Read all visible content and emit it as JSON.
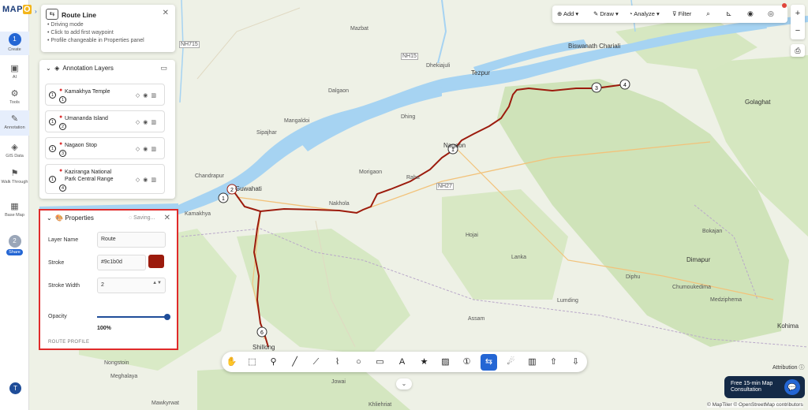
{
  "app": {
    "logo_text": "MAP",
    "logo_accent": "O",
    "brand_color": "#2466d4"
  },
  "rail": {
    "items": [
      {
        "label": "Create",
        "step": "1"
      },
      {
        "label": "AI"
      },
      {
        "label": "Tools"
      },
      {
        "label": "Annotation"
      },
      {
        "label": "GIS Data"
      },
      {
        "label": "Walk Through"
      },
      {
        "label": "Base Map"
      },
      {
        "label": "Share",
        "step": "2"
      }
    ],
    "avatar": "T"
  },
  "route_card": {
    "title": "Route Line",
    "tips": [
      "• Driving mode",
      "• Click to add first waypoint",
      "• Profile changeable in Properties panel"
    ]
  },
  "layers": {
    "title": "Annotation Layers",
    "items": [
      {
        "name": "Kamakhya Temple",
        "index": "1",
        "sub": "1"
      },
      {
        "name": "Umananda Island",
        "index": "1",
        "sub": "2"
      },
      {
        "name": "Nagaon Stop",
        "index": "1",
        "sub": "3"
      },
      {
        "name": "Kaziranga National Park Central Range",
        "index": "1",
        "sub": "4"
      }
    ]
  },
  "properties": {
    "title": "Properties",
    "status": "Saving...",
    "layer_name_label": "Layer Name",
    "layer_name_value": "Route",
    "stroke_label": "Stroke",
    "stroke_value": "#9c1b0d",
    "stroke_width_label": "Stroke Width",
    "stroke_width_value": "2",
    "opacity_label": "Opacity",
    "opacity_value": "100%",
    "opacity_fraction": 1.0,
    "section_label": "ROUTE PROFILE"
  },
  "toolbar": {
    "add": "Add",
    "draw": "Draw",
    "analyze": "Analyze",
    "filter": "Filter"
  },
  "map": {
    "labels": [
      "Biswanath Chariali",
      "Tezpur",
      "Golaghat",
      "Dhekiajuli",
      "Mazbat",
      "Mangaldoi",
      "Dalgaon",
      "Sipajhar",
      "Dhing",
      "Nagaon",
      "Morigaon",
      "Raha",
      "Nakhola",
      "Hojai",
      "Lanka",
      "Dimapur",
      "Diphu",
      "Lumding",
      "Chumoukedima",
      "Medziphema",
      "Kohima",
      "Nongstoin",
      "Jowai",
      "Khliehriat",
      "Mawkyrwat",
      "Meghalaya",
      "Assam",
      "Bokajan",
      "Shillong",
      "Guwahati",
      "Chandrapur",
      "Kamakhya"
    ],
    "roads": [
      "NH15",
      "NH27",
      "NH715"
    ],
    "route_color": "#9c1b0d"
  },
  "footer": {
    "consult": "Free 15-min Map Consultation",
    "attribution": "Attribution",
    "credits": "© MapTiler © OpenStreetMap contributors"
  }
}
